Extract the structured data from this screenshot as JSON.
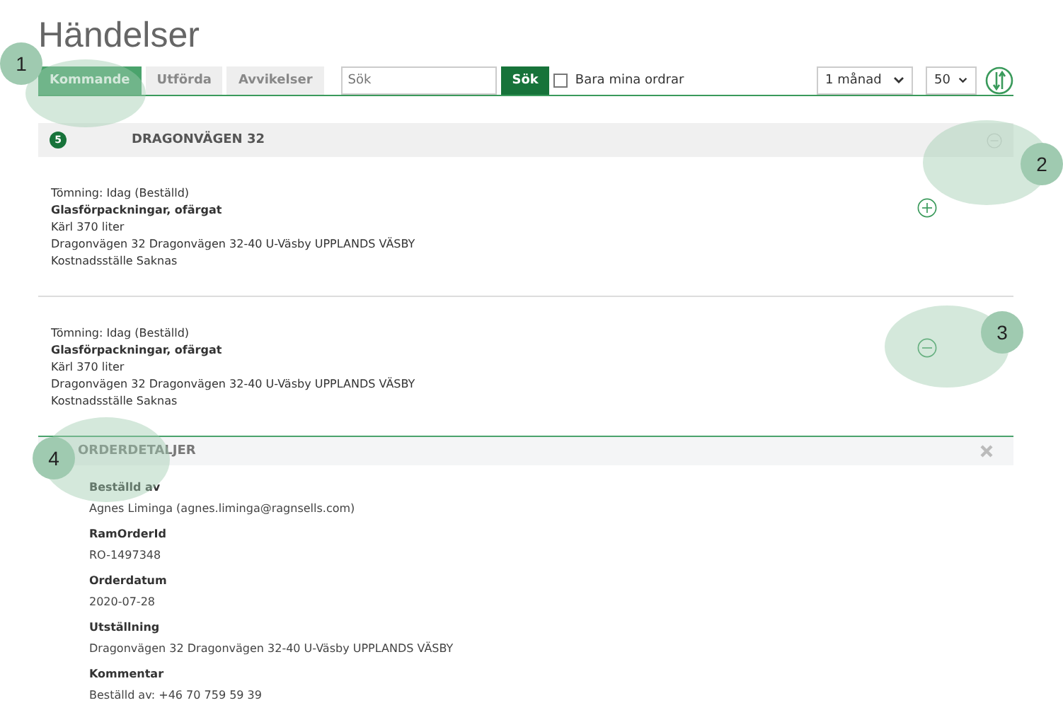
{
  "title": "Händelser",
  "tabs": [
    {
      "label": "Kommande",
      "selected": true
    },
    {
      "label": "Utförda",
      "selected": false
    },
    {
      "label": "Avvikelser",
      "selected": false
    }
  ],
  "search": {
    "placeholder": "Sök",
    "button": "Sök"
  },
  "filter": {
    "label": "Bara mina ordrar",
    "checked": false
  },
  "period_select": {
    "value": "1 månad"
  },
  "count_select": {
    "value": "50"
  },
  "group": {
    "badge": "5",
    "title": "DRAGONVÄGEN 32",
    "expanded": true
  },
  "events": [
    {
      "status": "Tömning: Idag (Beställd)",
      "material": "Glasförpackningar, ofärgat",
      "container": "Kärl 370 liter",
      "address": "Dragonvägen 32 Dragonvägen 32-40 U-Väsby UPPLANDS VÄSBY",
      "cost_center": "Kostnadsställe Saknas",
      "expanded": false
    },
    {
      "status": "Tömning: Idag (Beställd)",
      "material": "Glasförpackningar, ofärgat",
      "container": "Kärl 370 liter",
      "address": "Dragonvägen 32 Dragonvägen 32-40 U-Väsby UPPLANDS VÄSBY",
      "cost_center": "Kostnadsställe Saknas",
      "expanded": true
    }
  ],
  "order_details": {
    "title": "ORDERDETALJER",
    "fields": [
      {
        "label": "Beställd av",
        "value": "Agnes Liminga (agnes.liminga@ragnsells.com)"
      },
      {
        "label": "RamOrderId",
        "value": "RO-1497348"
      },
      {
        "label": "Orderdatum",
        "value": "2020-07-28"
      },
      {
        "label": "Utställning",
        "value": "Dragonvägen 32 Dragonvägen 32-40 U-Väsby UPPLANDS VÄSBY"
      },
      {
        "label": "Kommentar",
        "value": "Beställd av: +46 70 759 59 39"
      }
    ]
  },
  "callouts": [
    "1",
    "2",
    "3",
    "4"
  ]
}
